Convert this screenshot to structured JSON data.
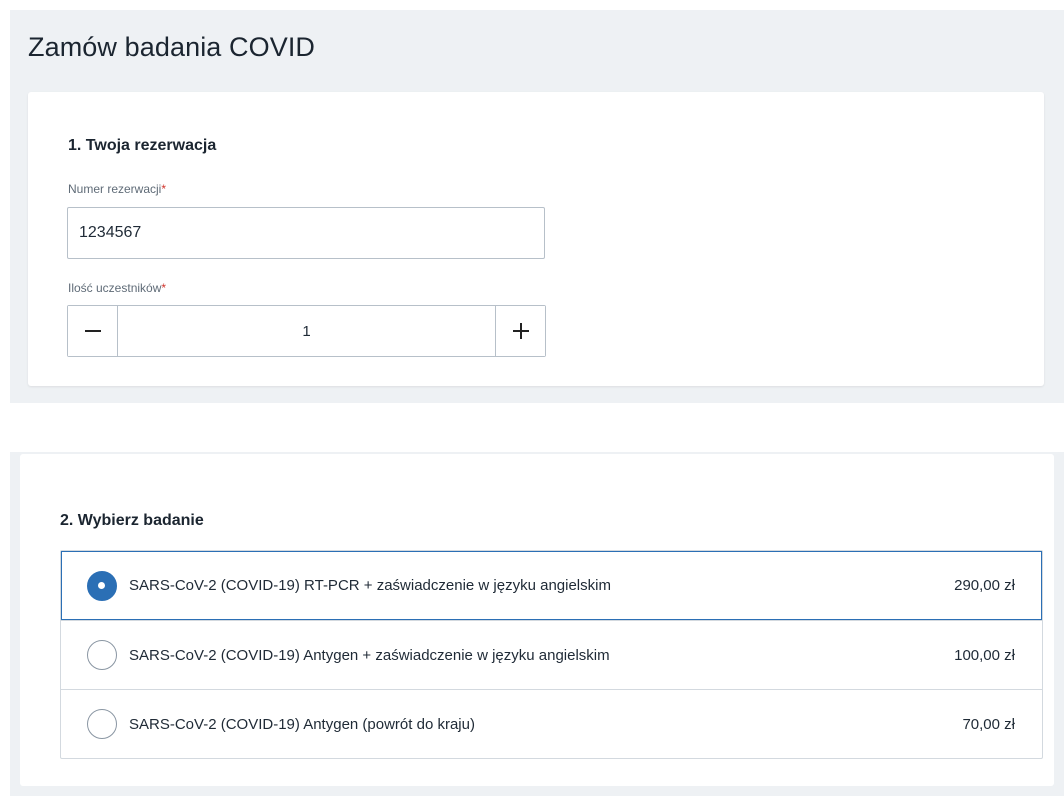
{
  "page": {
    "title": "Zamów badania COVID"
  },
  "reservation": {
    "section_title": "1. Twoja rezerwacja",
    "number_label": "Numer rezerwacji",
    "number_required": "*",
    "number_value": "1234567",
    "participants_label": "Ilość uczestników",
    "participants_required": "*",
    "participants_value": "1",
    "minus_icon": "minus-icon",
    "plus_icon": "plus-icon"
  },
  "tests": {
    "section_title": "2. Wybierz badanie",
    "options": [
      {
        "label": "SARS-CoV-2 (COVID-19) RT-PCR + zaświadczenie w języku angielskim",
        "price": "290,00 zł",
        "selected": true
      },
      {
        "label": "SARS-CoV-2 (COVID-19) Antygen + zaświadczenie w języku angielskim",
        "price": "100,00 zł",
        "selected": false
      },
      {
        "label": "SARS-CoV-2 (COVID-19) Antygen (powrót do kraju)",
        "price": "70,00 zł",
        "selected": false
      }
    ]
  },
  "colors": {
    "accent": "#2b6fb5",
    "required": "#d0342c",
    "panel_background": "#eef1f4"
  }
}
